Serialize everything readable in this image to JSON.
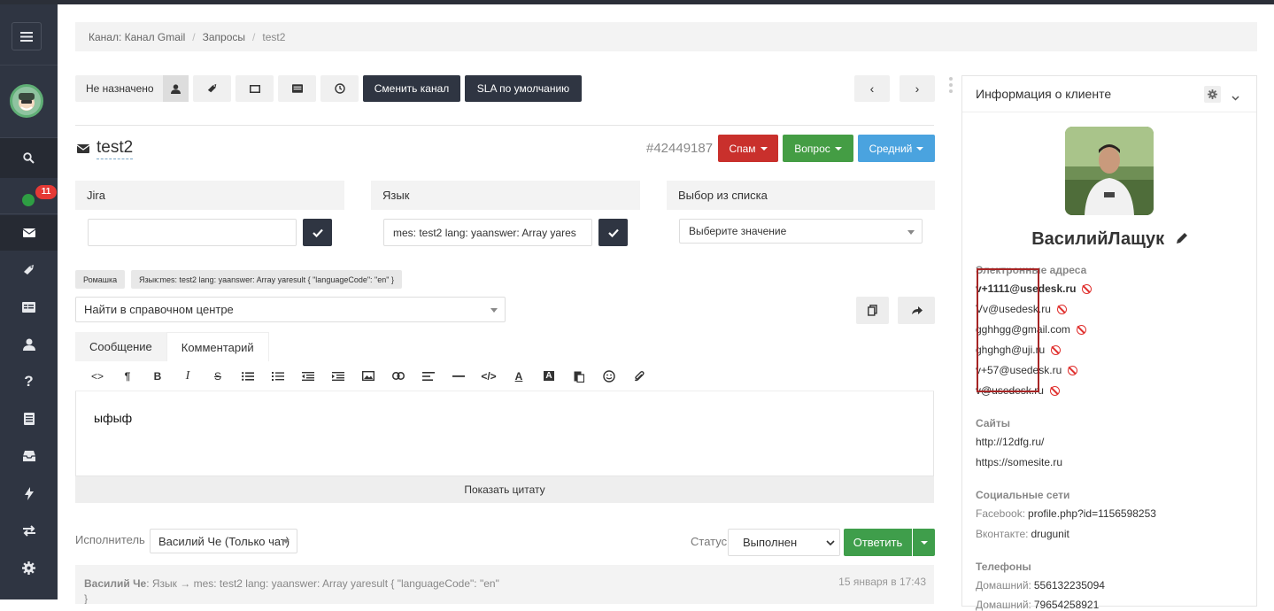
{
  "breadcrumb": [
    "Канал: Канал Gmail",
    "Запросы",
    "test2"
  ],
  "sidebar": {
    "items": [
      "menu-icon",
      "logo",
      "search-icon",
      "status-online",
      "mail-icon",
      "tag-icon",
      "list-icon",
      "user-icon",
      "help-icon",
      "document-icon",
      "inbox-icon",
      "flash-icon",
      "transfer-icon",
      "settings-icon"
    ],
    "badge": "11"
  },
  "toolbar": {
    "assignee": "Не назначено",
    "change_channel": "Сменить канал",
    "sla": "SLA по умолчанию"
  },
  "ticket": {
    "title": "test2",
    "id": "#42449187",
    "spam": "Спам",
    "type": "Вопрос",
    "priority": "Средний"
  },
  "fields": {
    "jira": {
      "label": "Jira",
      "value": ""
    },
    "lang": {
      "label": "Язык",
      "value": "mes: test2 lang:  yaanswer: Array yares"
    },
    "choice": {
      "label": "Выбор из списка",
      "placeholder": "Выберите значение"
    }
  },
  "tags": [
    "Ромашка",
    "Язык:mes: test2 lang: yaanswer: Array yaresult { \"languageCode\": \"en\" }"
  ],
  "kb_search": "Найти в справочном центре",
  "tabs": [
    "Сообщение",
    "Комментарий"
  ],
  "editor": {
    "text": "ыфыф",
    "quote_btn": "Показать цитату"
  },
  "footer": {
    "executor_label": "Исполнитель",
    "executor": "Василий Че (Только чат)",
    "status_label": "Статус",
    "status": "Выполнен",
    "reply": "Ответить"
  },
  "history": {
    "author": "Василий Че",
    "text": ": Язык → mes: test2 lang: yaanswer: Array yaresult { \"languageCode\": \"en\" }",
    "date": "15 января в 17:43"
  },
  "client": {
    "panel_title": "Информация о клиенте",
    "name": "ВасилийЛащук",
    "emails_title": "Электронные адреса",
    "emails": [
      "v+1111@usedesk.ru",
      "Vv@usedesk.ru",
      "gghhgg@gmail.com",
      "ghghgh@uji.ru",
      "v+57@usedesk.ru",
      "v@usedesk.ru"
    ],
    "sites_title": "Сайты",
    "sites": [
      "http://12dfg.ru/",
      "https://somesite.ru"
    ],
    "social_title": "Социальные сети",
    "social": [
      {
        "k": "Facebook:",
        "v": "profile.php?id=1156598253"
      },
      {
        "k": "Вконтакте:",
        "v": "drugunit"
      }
    ],
    "phones_title": "Телефоны",
    "phones": [
      {
        "k": "Домашний:",
        "v": "556132235094"
      },
      {
        "k": "Домашний:",
        "v": "79654258921"
      }
    ]
  },
  "colors": {
    "spam": "#c9302c",
    "question": "#449d44",
    "priority": "#4aa3df",
    "dark": "#2f3542",
    "sidebar": "#2f3542"
  }
}
